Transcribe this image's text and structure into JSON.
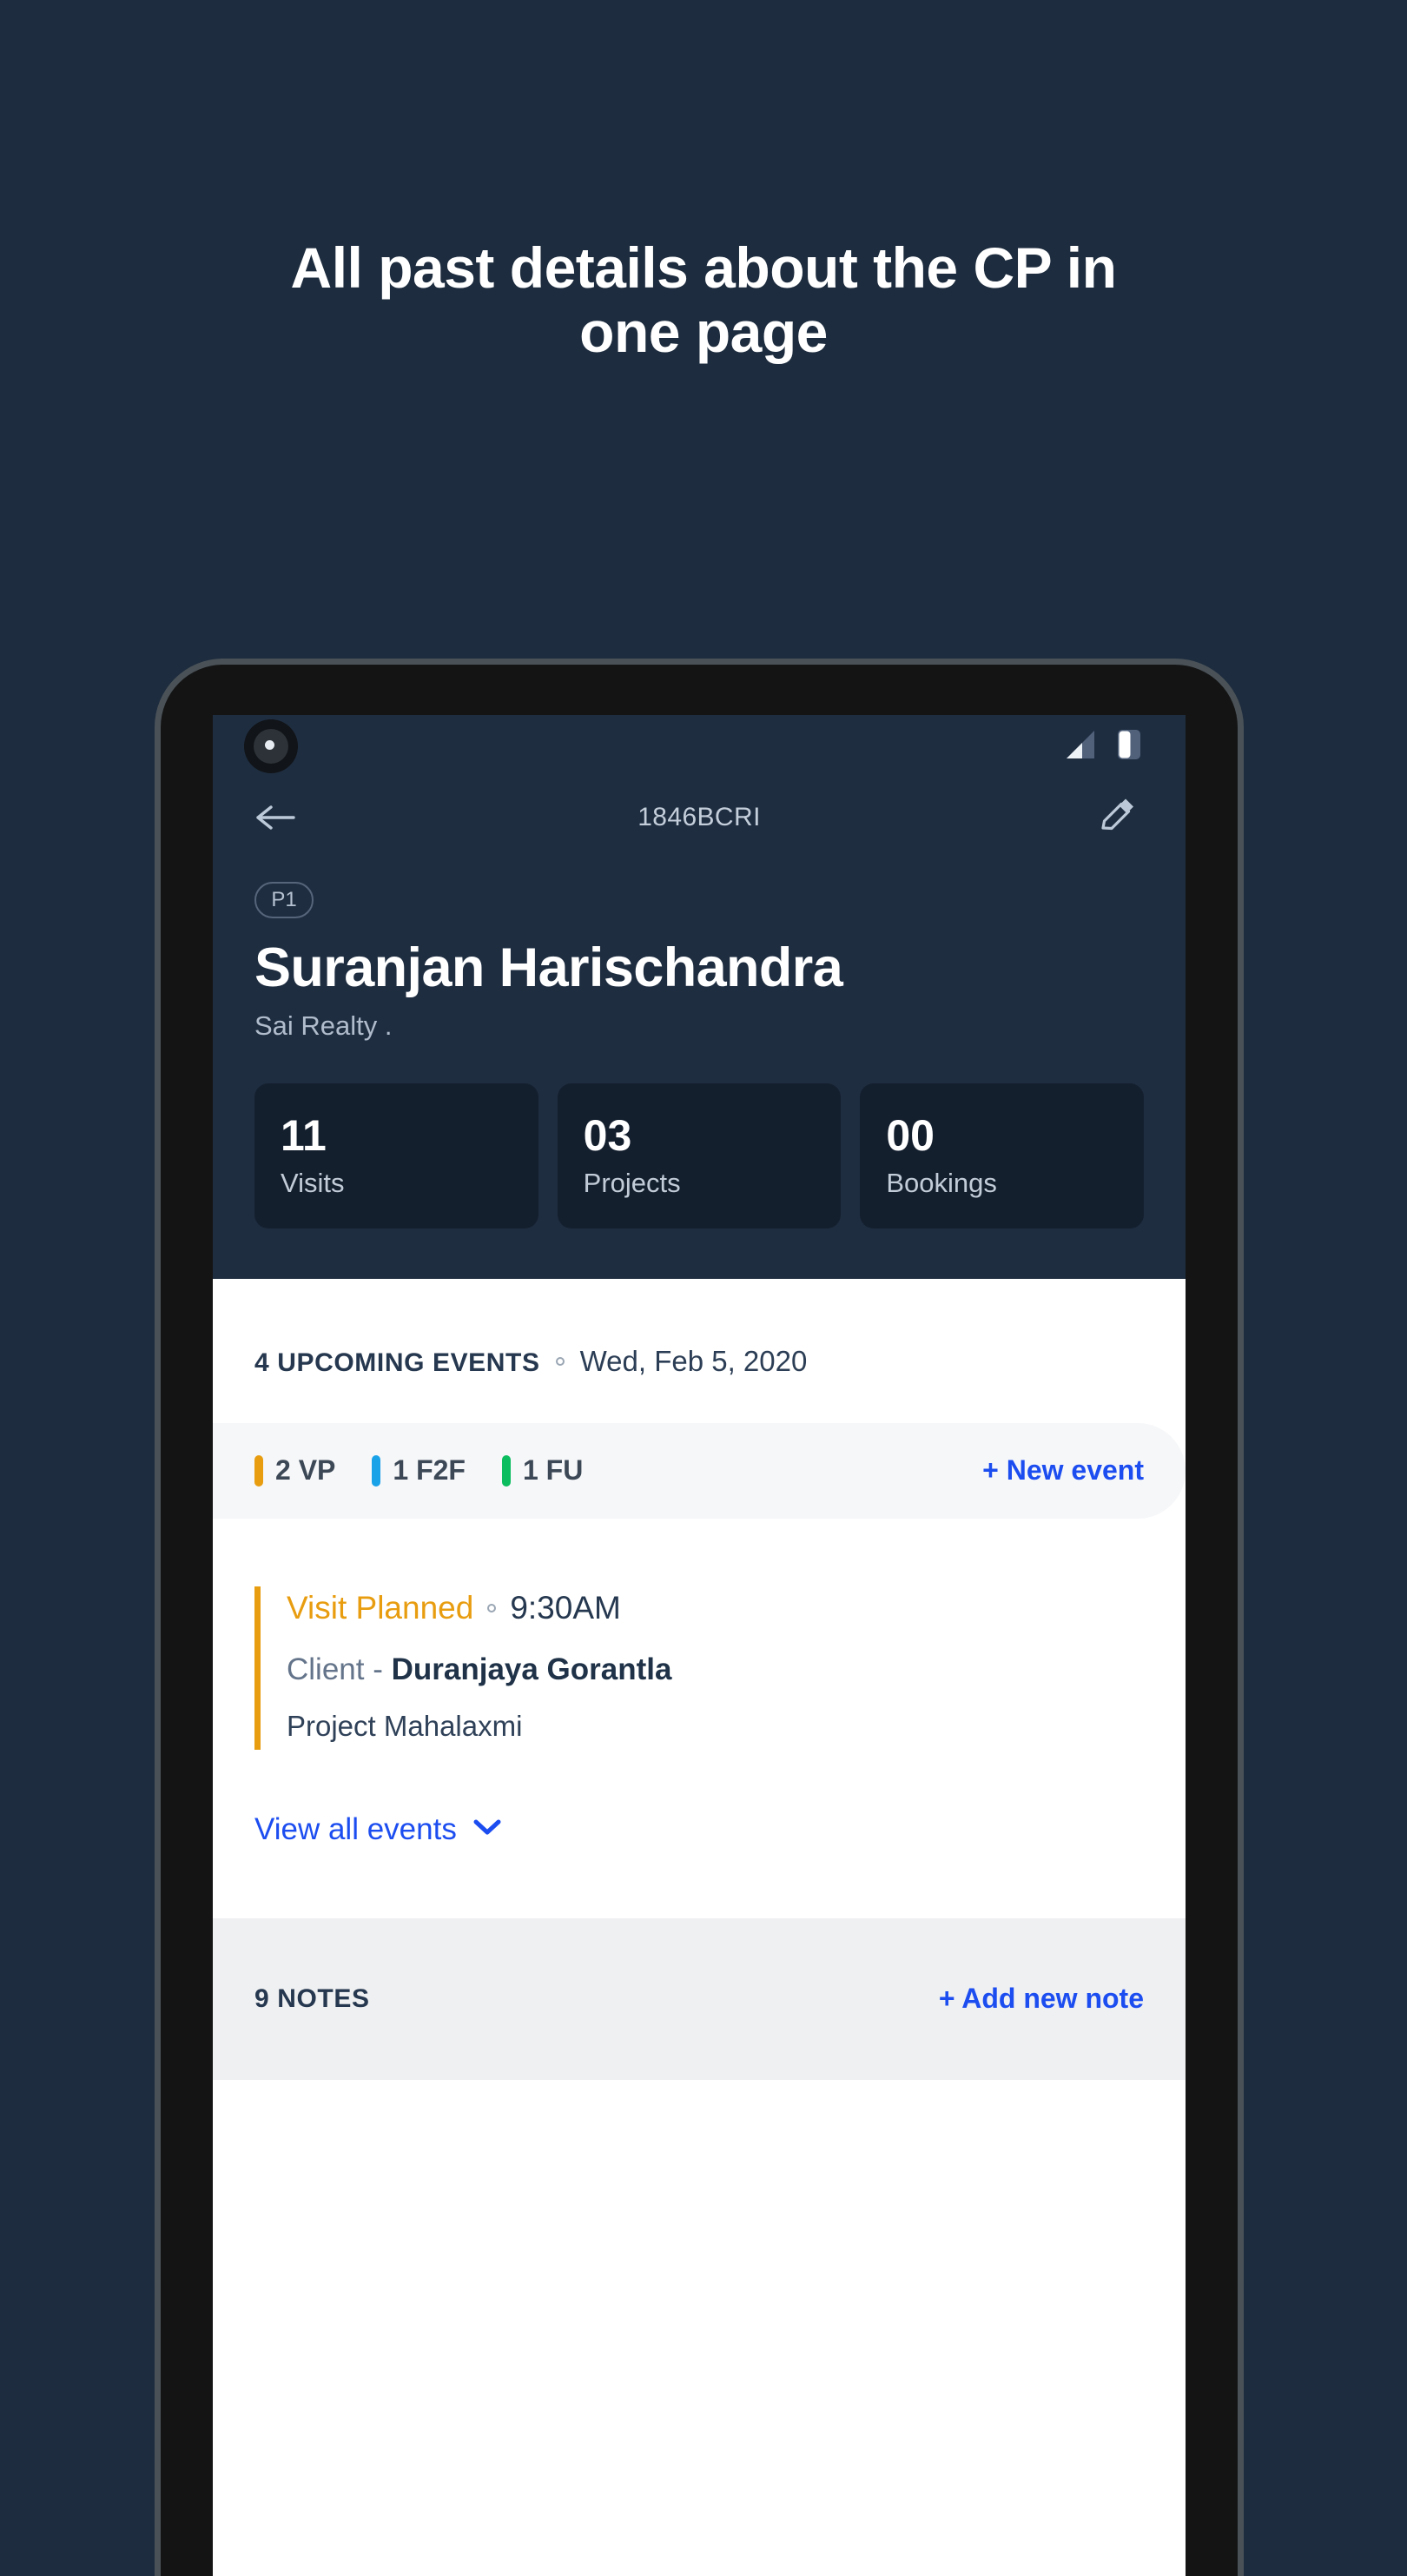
{
  "promo": {
    "line1": "All past details about the CP in",
    "line2": "one page"
  },
  "statusbar": {
    "camera_icon": "camera-punch-hole",
    "signal_icon": "signal-bars-icon",
    "battery_icon": "battery-icon"
  },
  "appbar": {
    "back_icon": "back-arrow-icon",
    "title": "1846BCRI",
    "edit_icon": "edit-pencil-icon"
  },
  "profile": {
    "badge": "P1",
    "name": "Suranjan Harischandra",
    "company": "Sai Realty ."
  },
  "stats": [
    {
      "value": "11",
      "label": "Visits"
    },
    {
      "value": "03",
      "label": "Projects"
    },
    {
      "value": "00",
      "label": "Bookings"
    }
  ],
  "events": {
    "count_label": "4 UPCOMING EVENTS",
    "date": "Wed, Feb 5, 2020",
    "legend": [
      {
        "text": "2 VP",
        "color": "#e89d10"
      },
      {
        "text": "1 F2F",
        "color": "#1aa2e8"
      },
      {
        "text": "1 FU",
        "color": "#0bbd5e"
      }
    ],
    "new_event_label": "+ New event",
    "card": {
      "type": "Visit Planned",
      "time": "9:30AM",
      "client_prefix": "Client - ",
      "client_name": "Duranjaya Gorantla",
      "project": "Project Mahalaxmi",
      "accent_color": "#e89d10"
    },
    "view_all_label": "View all events",
    "chevron_icon": "chevron-down-icon"
  },
  "notes": {
    "count_label": "9 NOTES",
    "add_label": "+ Add new note"
  },
  "colors": {
    "page_background": "#1d2c3e",
    "app_header": "#1e2d40",
    "stat_card": "#141f2e",
    "link_blue": "#1c4df0",
    "legend_bg": "#f6f7f9",
    "notes_bg": "#eff0f2"
  }
}
